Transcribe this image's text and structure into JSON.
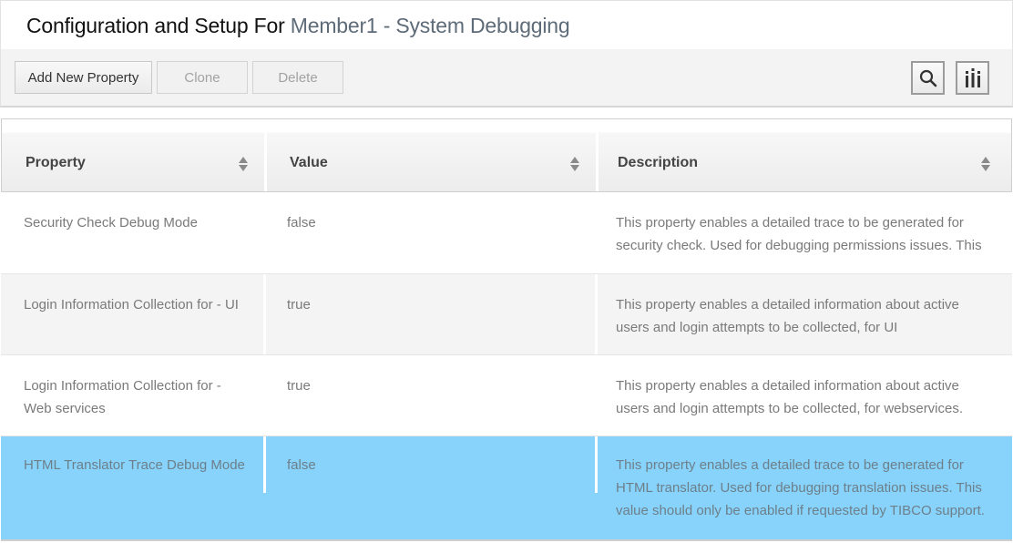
{
  "header": {
    "title_prefix": "Configuration and Setup For",
    "member_name": "Member1 - System Debugging"
  },
  "toolbar": {
    "add_label": "Add New Property",
    "clone_label": "Clone",
    "delete_label": "Delete",
    "search_icon": "search-icon",
    "columns_icon": "columns-icon"
  },
  "table": {
    "columns": [
      "Property",
      "Value",
      "Description"
    ],
    "rows": [
      {
        "property": "Security Check Debug Mode",
        "value": "false",
        "description_lines": [
          "This property enables a detailed trace to be generated for",
          "security check. Used for debugging permissions issues. This"
        ]
      },
      {
        "property": "Login Information Collection for - UI",
        "value": "true",
        "description_lines": [
          "This property enables a detailed information about active",
          "users and login attempts to be collected, for UI"
        ]
      },
      {
        "property_lines": [
          "Login Information Collection for -",
          "Web services"
        ],
        "value": "true",
        "description_lines": [
          "This property enables a detailed information about active",
          "users and login attempts to be collected, for webservices."
        ]
      },
      {
        "property": "HTML Translator Trace Debug Mode",
        "value": "false",
        "selected": true,
        "description_lines": [
          "This property enables a detailed trace to be generated for",
          "HTML translator. Used for debugging translation issues. This",
          "value should only be enabled if requested by TIBCO support."
        ]
      }
    ]
  },
  "colors": {
    "selected_row": "#87d3fb",
    "alt_row": "#f4f4f4",
    "member_text": "#5e6b78"
  }
}
